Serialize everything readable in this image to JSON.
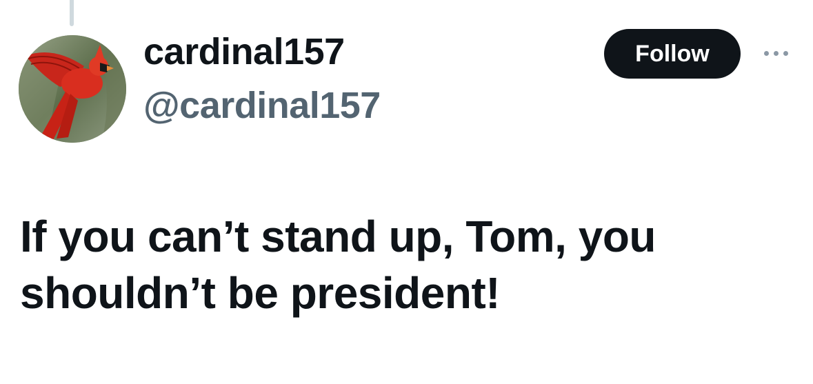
{
  "author": {
    "display_name": "cardinal157",
    "handle": "@cardinal157",
    "avatar_icon": "cardinal-bird-photo"
  },
  "actions": {
    "follow_label": "Follow",
    "more_icon": "ellipsis-icon"
  },
  "tweet": {
    "text": "If you can’t stand up, Tom, you shouldn’t be president!"
  },
  "colors": {
    "text_primary": "#0f1419",
    "text_secondary": "#536471",
    "follow_bg": "#0f1419",
    "follow_text": "#ffffff",
    "thread_line": "#cfd9de"
  }
}
